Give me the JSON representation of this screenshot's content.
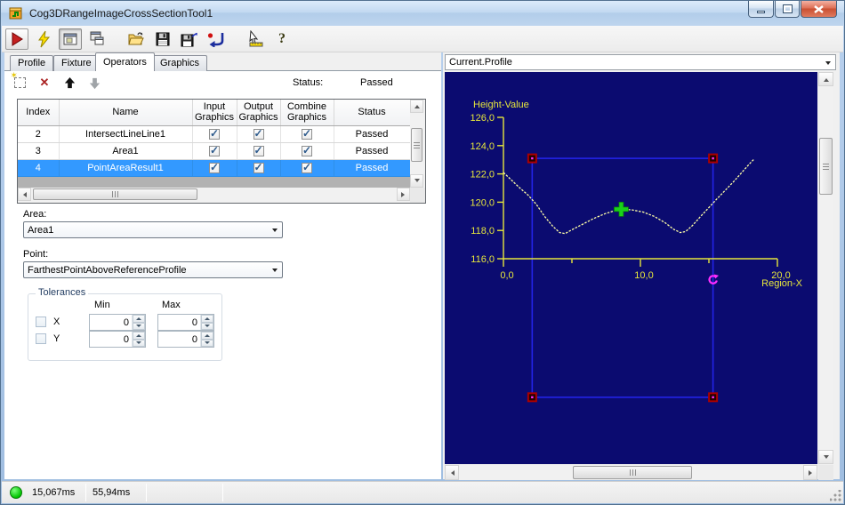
{
  "window": {
    "title": "Cog3DRangeImageCrossSectionTool1"
  },
  "icons": {
    "app": "3d-range-tool-icon",
    "help_glyph": "?",
    "sparkle": "✶",
    "delete_x": "✕",
    "check": "✓",
    "toolbar_names": [
      "run-icon",
      "trigger-lightning-icon",
      "show-result-window-icon",
      "float-window-icon",
      "open-file-icon",
      "save-file-icon",
      "save-as-icon",
      "reset-icon",
      "measure-pointer-icon",
      "help-icon"
    ]
  },
  "tabs": [
    {
      "label": "Profile",
      "active": false
    },
    {
      "label": "Fixture",
      "active": false
    },
    {
      "label": "Operators",
      "active": true
    },
    {
      "label": "Graphics",
      "active": false
    }
  ],
  "operators": {
    "status_label": "Status:",
    "status_value": "Passed",
    "table": {
      "columns": [
        "Index",
        "Name",
        "Input Graphics",
        "Output Graphics",
        "Combine Graphics",
        "Status"
      ],
      "rows": [
        {
          "index": "2",
          "name": "IntersectLineLine1",
          "input_graphics": true,
          "output_graphics": true,
          "combine_graphics": true,
          "status": "Passed",
          "selected": false
        },
        {
          "index": "3",
          "name": "Area1",
          "input_graphics": true,
          "output_graphics": true,
          "combine_graphics": true,
          "status": "Passed",
          "selected": false
        },
        {
          "index": "4",
          "name": "PointAreaResult1",
          "input_graphics": true,
          "output_graphics": true,
          "combine_graphics": true,
          "status": "Passed",
          "selected": true
        }
      ]
    },
    "area_label": "Area:",
    "area_value": "Area1",
    "point_label": "Point:",
    "point_value": "FarthestPointAboveReferenceProfile",
    "tolerances": {
      "legend": "Tolerances",
      "col_min": "Min",
      "col_max": "Max",
      "rows": [
        {
          "label": "X",
          "min": "0",
          "max": "0",
          "checked": false
        },
        {
          "label": "Y",
          "min": "0",
          "max": "0",
          "checked": false
        }
      ]
    }
  },
  "display": {
    "source_value": "Current.Profile"
  },
  "status_bar": {
    "time1": "15,067ms",
    "time2": "55,94ms"
  },
  "chart_data": {
    "type": "line",
    "title": "",
    "xlabel": "Region-X",
    "ylabel": "Height-Value",
    "xlim": [
      0,
      20
    ],
    "ylim": [
      116,
      126
    ],
    "x_major_ticks": [
      0,
      10,
      20
    ],
    "x_minor_ticks": [
      5,
      15
    ],
    "y_ticks": [
      116,
      118,
      120,
      122,
      124,
      126
    ],
    "decimal_separator": ",",
    "grid": false,
    "background": "#0b0b70",
    "axis_color": "#e6e63c",
    "series": [
      {
        "name": "cross-section-profile",
        "color": "#ffffa6",
        "points": [
          [
            0,
            122.1
          ],
          [
            0.6,
            121.55
          ],
          [
            1.2,
            121.0
          ],
          [
            1.8,
            120.5
          ],
          [
            2.4,
            119.85
          ],
          [
            3.0,
            119.0
          ],
          [
            3.6,
            118.3
          ],
          [
            4.1,
            117.85
          ],
          [
            4.5,
            117.78
          ],
          [
            5.0,
            118.05
          ],
          [
            5.8,
            118.45
          ],
          [
            6.6,
            118.85
          ],
          [
            7.4,
            119.18
          ],
          [
            8.2,
            119.42
          ],
          [
            8.8,
            119.5
          ],
          [
            9.4,
            119.45
          ],
          [
            10.2,
            119.3
          ],
          [
            11.0,
            119.0
          ],
          [
            11.8,
            118.55
          ],
          [
            12.4,
            118.1
          ],
          [
            12.9,
            117.85
          ],
          [
            13.3,
            117.92
          ],
          [
            13.8,
            118.35
          ],
          [
            14.4,
            119.0
          ],
          [
            15.0,
            119.62
          ],
          [
            15.6,
            120.25
          ],
          [
            16.2,
            120.85
          ],
          [
            16.8,
            121.45
          ],
          [
            17.4,
            122.1
          ],
          [
            18.0,
            122.75
          ],
          [
            18.3,
            123.05
          ]
        ]
      }
    ],
    "region": {
      "x1": 2.1,
      "x2": 15.3,
      "y_top": 123.1,
      "y_bottom": 106.2,
      "color": "#2323e6"
    },
    "markers": {
      "corner_color": "#aa0000",
      "corner_center_color": "#ff2cff",
      "result_point": {
        "x": 8.6,
        "y": 119.5,
        "shape": "cross",
        "color": "#1ad11a"
      },
      "rotation_handle": {
        "x": 15.3,
        "y": 114.55,
        "shape": "rotation-arrow",
        "color": "#ff2cff"
      }
    }
  }
}
